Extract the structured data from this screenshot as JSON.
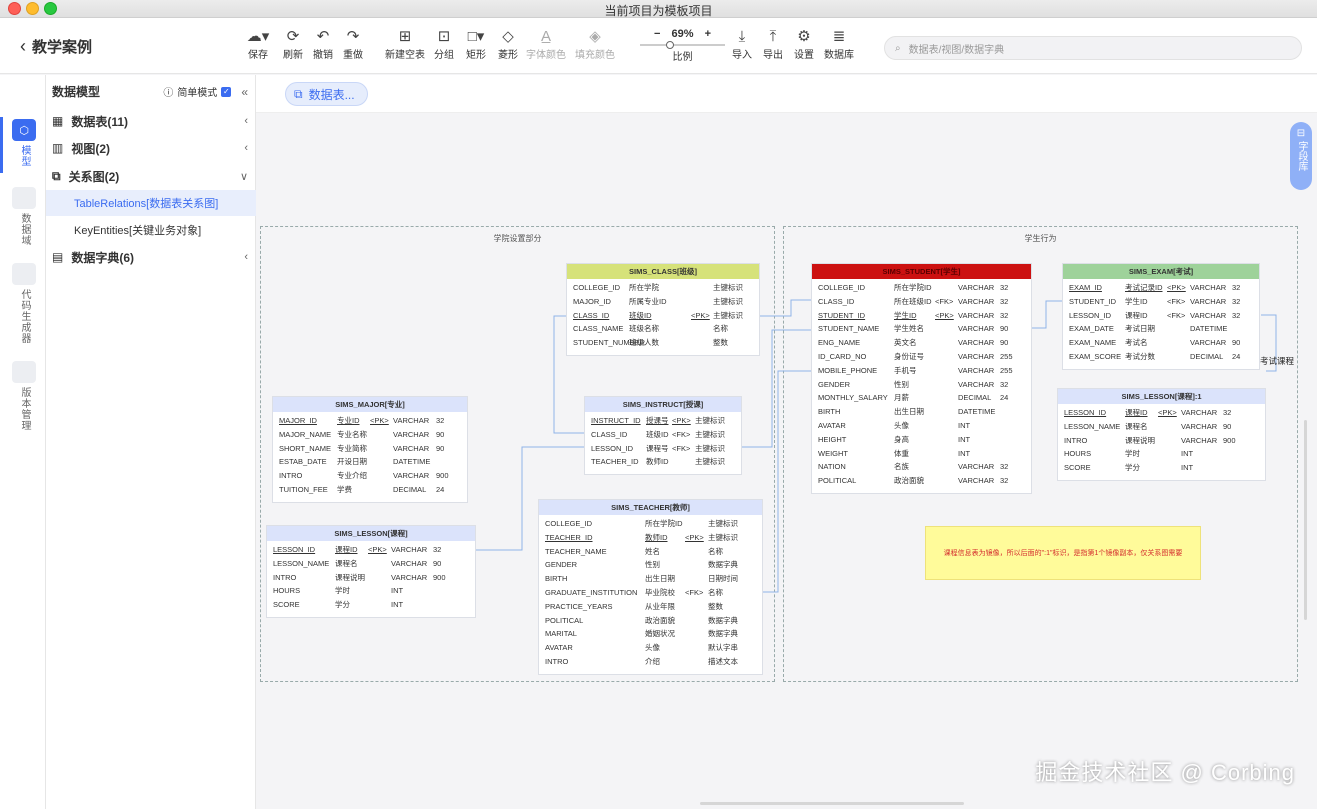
{
  "window": {
    "title": "当前项目为模板项目"
  },
  "header": {
    "back_label": "教学案例"
  },
  "toolbar": {
    "items": [
      {
        "label": "保存",
        "icon": "cloud-upload-icon"
      },
      {
        "label": "刷新",
        "icon": "refresh-icon"
      },
      {
        "label": "撤销",
        "icon": "undo-icon"
      },
      {
        "label": "重做",
        "icon": "redo-icon"
      },
      {
        "label": "新建空表",
        "icon": "new-table-icon"
      },
      {
        "label": "分组",
        "icon": "group-icon"
      },
      {
        "label": "矩形",
        "icon": "rectangle-icon"
      },
      {
        "label": "菱形",
        "icon": "diamond-icon"
      },
      {
        "label": "字体颜色",
        "icon": "font-color-icon"
      },
      {
        "label": "填充颜色",
        "icon": "fill-color-icon"
      },
      {
        "label": "导入",
        "icon": "import-icon"
      },
      {
        "label": "导出",
        "icon": "export-icon"
      },
      {
        "label": "设置",
        "icon": "gear-icon"
      },
      {
        "label": "数据库",
        "icon": "database-icon"
      }
    ],
    "zoom": {
      "value": "69%",
      "label": "比例",
      "minus": "−",
      "plus": "+",
      "level": 0.69
    }
  },
  "search": {
    "placeholder": "数据表/视图/数据字典"
  },
  "rail": {
    "items": [
      {
        "label": "模型",
        "active": true
      },
      {
        "label": "数据域"
      },
      {
        "label": "代码生成器"
      },
      {
        "label": "版本管理"
      }
    ]
  },
  "sidebar": {
    "title": "数据模型",
    "simple_mode": "简单模式",
    "collapse": "«",
    "tree": [
      {
        "label": "数据表(11)",
        "icon": "table-icon",
        "arrow": "‹"
      },
      {
        "label": "视图(2)",
        "icon": "chart-icon",
        "arrow": "‹"
      },
      {
        "label": "关系图(2)",
        "icon": "diagram-icon",
        "arrow": "∨"
      },
      {
        "label": "数据字典(6)",
        "icon": "book-icon",
        "arrow": "‹"
      }
    ],
    "diagrams": [
      "TableRelations[数据表关系图]",
      "KeyEntities[关键业务对象]"
    ]
  },
  "canvas": {
    "tab": "数据表...",
    "field_library": "字段库",
    "groups": [
      "学院设置部分",
      "学生行为"
    ],
    "float_label": "考试课程",
    "note": "课程信息表为镜像，所以后面的\":1\"标识，是指第1个镜像副本，仅关系图需要",
    "colors": {
      "class": "#d6e27a",
      "instruct": "#dbe3fb",
      "major": "#dbe3fb",
      "lesson": "#dbe3fb",
      "teacher": "#dbe3fb",
      "student": "#cc1111",
      "exam": "#9ed29a",
      "lesson1": "#dbe3fb"
    },
    "entities": {
      "class": {
        "title": "SIMS_CLASS[班级]",
        "rows": [
          [
            "COLLEGE_ID",
            "所在学院",
            "",
            "主键标识"
          ],
          [
            "MAJOR_ID",
            "所属专业ID",
            "",
            "主键标识"
          ],
          [
            "CLASS_ID",
            "班级ID",
            "<PK>",
            "主键标识"
          ],
          [
            "CLASS_NAME",
            "班级名称",
            "",
            "名称"
          ],
          [
            "STUDENT_NUMBER",
            "班级人数",
            "",
            "整数"
          ]
        ]
      },
      "instruct": {
        "title": "SIMS_INSTRUCT[授课]",
        "rows": [
          [
            "INSTRUCT_ID",
            "授课号",
            "<PK>",
            "主键标识"
          ],
          [
            "CLASS_ID",
            "班级ID",
            "<FK>",
            "主键标识"
          ],
          [
            "LESSON_ID",
            "课程号",
            "<FK>",
            "主键标识"
          ],
          [
            "TEACHER_ID",
            "教师ID",
            "",
            "主键标识"
          ]
        ]
      },
      "major": {
        "title": "SIMS_MAJOR[专业]",
        "rows": [
          [
            "MAJOR_ID",
            "专业ID",
            "<PK>",
            "VARCHAR",
            "32"
          ],
          [
            "MAJOR_NAME",
            "专业名称",
            "",
            "VARCHAR",
            "90"
          ],
          [
            "SHORT_NAME",
            "专业简称",
            "",
            "VARCHAR",
            "90"
          ],
          [
            "ESTAB_DATE",
            "开设日期",
            "",
            "DATETIME",
            ""
          ],
          [
            "INTRO",
            "专业介绍",
            "",
            "VARCHAR",
            "900"
          ],
          [
            "TUITION_FEE",
            "学费",
            "",
            "DECIMAL",
            "24"
          ]
        ]
      },
      "lesson": {
        "title": "SIMS_LESSON[课程]",
        "rows": [
          [
            "LESSON_ID",
            "课程ID",
            "<PK>",
            "VARCHAR",
            "32"
          ],
          [
            "LESSON_NAME",
            "课程名",
            "",
            "VARCHAR",
            "90"
          ],
          [
            "INTRO",
            "课程说明",
            "",
            "VARCHAR",
            "900"
          ],
          [
            "HOURS",
            "学时",
            "",
            "INT",
            ""
          ],
          [
            "SCORE",
            "学分",
            "",
            "INT",
            ""
          ]
        ]
      },
      "teacher": {
        "title": "SIMS_TEACHER[教师]",
        "rows": [
          [
            "COLLEGE_ID",
            "所在学院ID",
            "",
            "主键标识"
          ],
          [
            "TEACHER_ID",
            "教师ID",
            "<PK>",
            "主键标识"
          ],
          [
            "TEACHER_NAME",
            "姓名",
            "",
            "名称"
          ],
          [
            "GENDER",
            "性别",
            "",
            "数据字典"
          ],
          [
            "BIRTH",
            "出生日期",
            "",
            "日期时间"
          ],
          [
            "GRADUATE_INSTITUTION",
            "毕业院校",
            "<FK>",
            "名称"
          ],
          [
            "PRACTICE_YEARS",
            "从业年限",
            "",
            "整数"
          ],
          [
            "POLITICAL",
            "政治面貌",
            "",
            "数据字典"
          ],
          [
            "MARITAL",
            "婚姻状况",
            "",
            "数据字典"
          ],
          [
            "AVATAR",
            "头像",
            "",
            "默认字串"
          ],
          [
            "INTRO",
            "介绍",
            "",
            "描述文本"
          ]
        ]
      },
      "student": {
        "title": "SIMS_STUDENT[学生]",
        "rows": [
          [
            "COLLEGE_ID",
            "所在学院ID",
            "",
            "VARCHAR",
            "32"
          ],
          [
            "CLASS_ID",
            "所在班级ID",
            "<FK>",
            "VARCHAR",
            "32"
          ],
          [
            "STUDENT_ID",
            "学生ID",
            "<PK>",
            "VARCHAR",
            "32"
          ],
          [
            "STUDENT_NAME",
            "学生姓名",
            "",
            "VARCHAR",
            "90"
          ],
          [
            "ENG_NAME",
            "英文名",
            "",
            "VARCHAR",
            "90"
          ],
          [
            "ID_CARD_NO",
            "身份证号",
            "",
            "VARCHAR",
            "255"
          ],
          [
            "MOBILE_PHONE",
            "手机号",
            "",
            "VARCHAR",
            "255"
          ],
          [
            "GENDER",
            "性别",
            "",
            "VARCHAR",
            "32"
          ],
          [
            "MONTHLY_SALARY",
            "月薪",
            "",
            "DECIMAL",
            "24"
          ],
          [
            "BIRTH",
            "出生日期",
            "",
            "DATETIME",
            ""
          ],
          [
            "AVATAR",
            "头像",
            "",
            "INT",
            ""
          ],
          [
            "HEIGHT",
            "身高",
            "",
            "INT",
            ""
          ],
          [
            "WEIGHT",
            "体重",
            "",
            "INT",
            ""
          ],
          [
            "NATION",
            "名族",
            "",
            "VARCHAR",
            "32"
          ],
          [
            "POLITICAL",
            "政治面貌",
            "",
            "VARCHAR",
            "32"
          ]
        ]
      },
      "exam": {
        "title": "SIMS_EXAM[考试]",
        "rows": [
          [
            "EXAM_ID",
            "考试记录ID",
            "<PK>",
            "VARCHAR",
            "32"
          ],
          [
            "STUDENT_ID",
            "学生ID",
            "<FK>",
            "VARCHAR",
            "32"
          ],
          [
            "LESSON_ID",
            "课程ID",
            "<FK>",
            "VARCHAR",
            "32"
          ],
          [
            "EXAM_DATE",
            "考试日期",
            "",
            "DATETIME",
            ""
          ],
          [
            "EXAM_NAME",
            "考试名",
            "",
            "VARCHAR",
            "90"
          ],
          [
            "EXAM_SCORE",
            "考试分数",
            "",
            "DECIMAL",
            "24"
          ]
        ]
      },
      "lesson1": {
        "title": "SIMS_LESSON[课程]:1",
        "rows": [
          [
            "LESSON_ID",
            "课程ID",
            "<PK>",
            "VARCHAR",
            "32"
          ],
          [
            "LESSON_NAME",
            "课程名",
            "",
            "VARCHAR",
            "90"
          ],
          [
            "INTRO",
            "课程说明",
            "",
            "VARCHAR",
            "900"
          ],
          [
            "HOURS",
            "学时",
            "",
            "INT",
            ""
          ],
          [
            "SCORE",
            "学分",
            "",
            "INT",
            ""
          ]
        ]
      }
    }
  },
  "watermark": "掘金技术社区 @ Corbing"
}
